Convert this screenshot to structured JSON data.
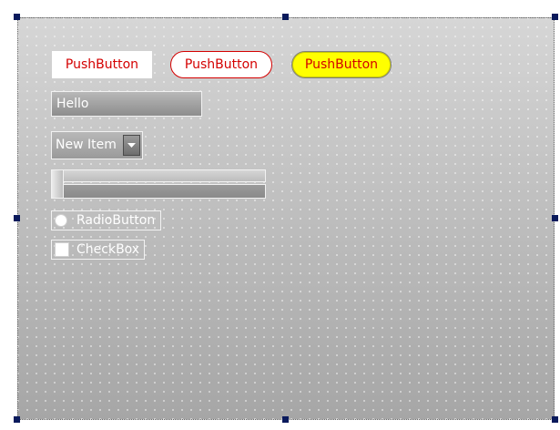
{
  "form": {
    "buttons": [
      {
        "label": "PushButton",
        "style": "plain",
        "text_color": "#d40000",
        "background": "#ffffff"
      },
      {
        "label": "PushButton",
        "style": "rounded",
        "text_color": "#d40000",
        "background": "#ffffff",
        "border_color": "#d40000"
      },
      {
        "label": "PushButton",
        "style": "rounded",
        "text_color": "#d40000",
        "background": "#ffff00"
      }
    ],
    "line_edit": {
      "value": "Hello"
    },
    "combo_box": {
      "selected": "New Item"
    },
    "slider": {
      "value_fraction": 0.0
    },
    "radio_button": {
      "label": "RadioButton",
      "checked": false
    },
    "check_box": {
      "label": "CheckBox",
      "checked": false
    }
  },
  "colors": {
    "selection_handle": "#0a1a5c",
    "button_text": "#d40000",
    "highlight_button": "#ffff00"
  },
  "icons": {
    "combo_arrow": "chevron-down-icon"
  }
}
